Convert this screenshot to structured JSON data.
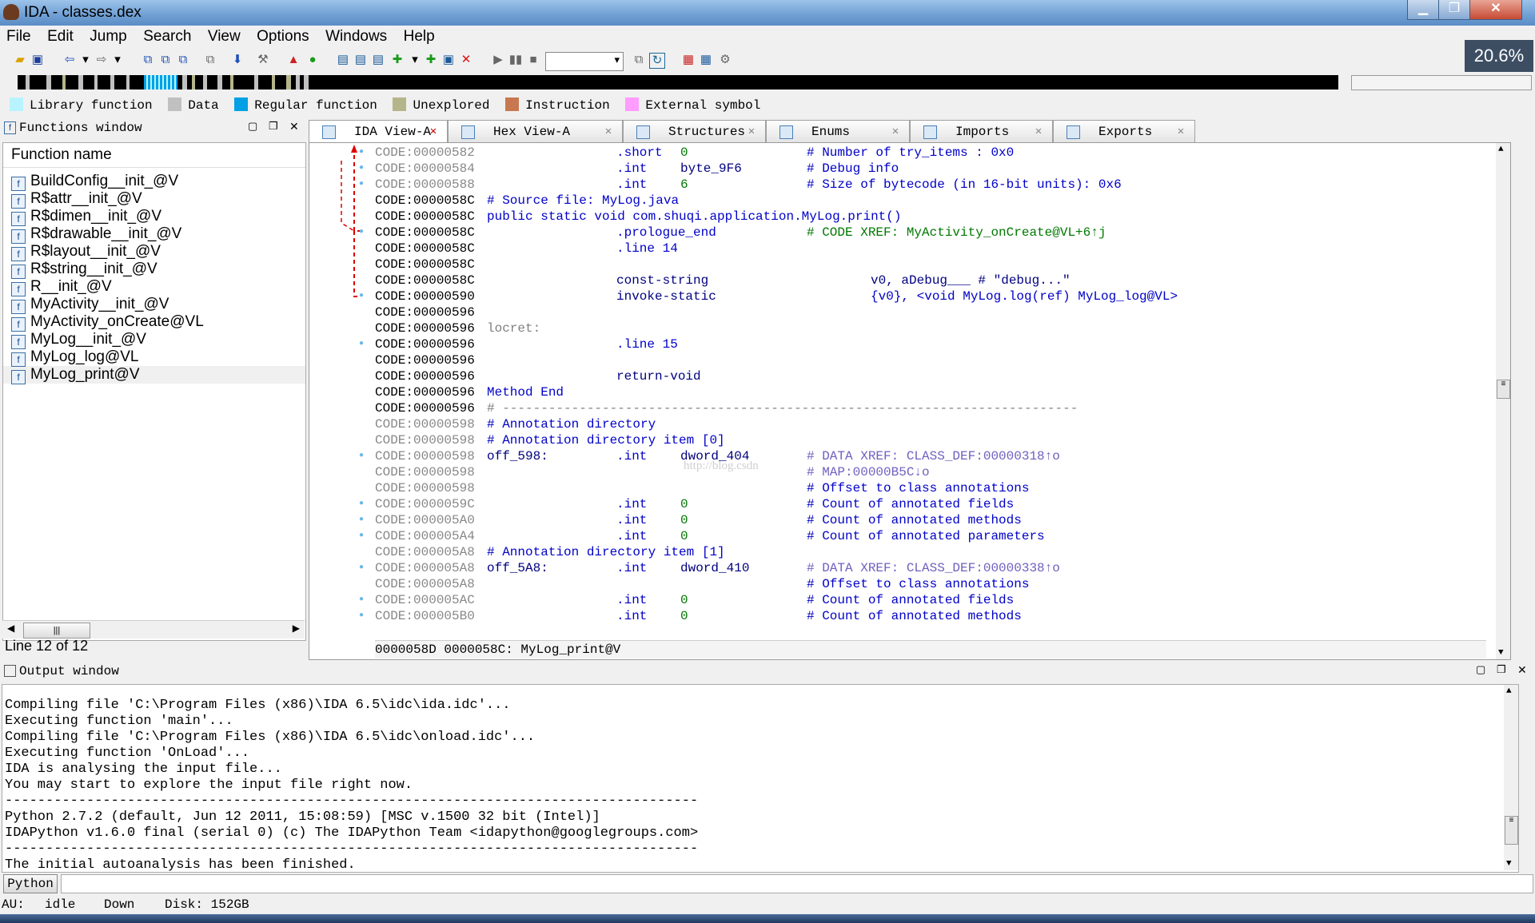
{
  "window": {
    "title": "IDA - classes.dex",
    "zoom": "20.6%"
  },
  "menu": [
    "File",
    "Edit",
    "Jump",
    "Search",
    "View",
    "Options",
    "Windows",
    "Help"
  ],
  "legend": [
    {
      "label": "Library function",
      "color": "#b8f4ff"
    },
    {
      "label": "Data",
      "color": "#c0c0c0"
    },
    {
      "label": "Regular function",
      "color": "#00a0e6"
    },
    {
      "label": "Unexplored",
      "color": "#b5b58a"
    },
    {
      "label": "Instruction",
      "color": "#c87850"
    },
    {
      "label": "External symbol",
      "color": "#ff9cff"
    }
  ],
  "functions": {
    "title": "Functions window",
    "column": "Function name",
    "items": [
      "BuildConfig__init_@V",
      "R$attr__init_@V",
      "R$dimen__init_@V",
      "R$drawable__init_@V",
      "R$layout__init_@V",
      "R$string__init_@V",
      "R__init_@V",
      "MyActivity__init_@V",
      "MyActivity_onCreate@VL",
      "MyLog__init_@V",
      "MyLog_log@VL",
      "MyLog_print@V"
    ],
    "selected": 11,
    "status": "Line 12 of 12"
  },
  "tabs": [
    "IDA View-A",
    "Hex View-A",
    "Structures",
    "Enums",
    "Imports",
    "Exports"
  ],
  "code": {
    "lines": [
      {
        "addr": "CODE:00000582",
        "addr_style": "gray",
        "dot": true,
        "ins": ".short",
        "op": "0",
        "op_color": "green",
        "cm": "# Number of try_items : 0x0"
      },
      {
        "addr": "CODE:00000584",
        "addr_style": "gray",
        "dot": true,
        "ins": ".int",
        "op": "byte_9F6",
        "op_color": "navy",
        "cm": "# Debug info"
      },
      {
        "addr": "CODE:00000588",
        "addr_style": "gray",
        "dot": true,
        "ins": ".int",
        "op": "6",
        "op_color": "green",
        "cm": "# Size of bytecode (in 16-bit units): 0x6"
      },
      {
        "addr": "CODE:0000058C",
        "addr_style": "dark",
        "lbl": "# Source file: MyLog.java",
        "lbl_color": "blue"
      },
      {
        "addr": "CODE:0000058C",
        "addr_style": "dark",
        "lbl": "public static void com.shuqi.application.MyLog.print()",
        "lbl_color": "blue"
      },
      {
        "addr": "CODE:0000058C",
        "addr_style": "dark",
        "dot": true,
        "ins": ".prologue_end",
        "cm": "# CODE XREF: MyActivity_onCreate@VL+6↑j",
        "cm_color": "green"
      },
      {
        "addr": "CODE:0000058C",
        "addr_style": "dark",
        "ins": ".line 14"
      },
      {
        "addr": "CODE:0000058C",
        "addr_style": "dark"
      },
      {
        "addr": "CODE:0000058C",
        "addr_style": "dark",
        "ins": "const-string",
        "ins_color": "navy",
        "op2": "v0, aDebug___ # \"debug...\"",
        "op2_color": "navy"
      },
      {
        "addr": "CODE:00000590",
        "addr_style": "dark",
        "dot": true,
        "ins": "invoke-static",
        "ins_color": "navy",
        "op2": "{v0}, <void MyLog.log(ref) MyLog_log@VL>",
        "op2_color": "blue"
      },
      {
        "addr": "CODE:00000596",
        "addr_style": "dark"
      },
      {
        "addr": "CODE:00000596",
        "addr_style": "dark",
        "lbl": "locret:",
        "lbl_color": "gray"
      },
      {
        "addr": "CODE:00000596",
        "addr_style": "dark",
        "dot": true,
        "ins": ".line 15"
      },
      {
        "addr": "CODE:00000596",
        "addr_style": "dark"
      },
      {
        "addr": "CODE:00000596",
        "addr_style": "dark",
        "ins": "return-void",
        "ins_color": "navy"
      },
      {
        "addr": "CODE:00000596",
        "addr_style": "dark",
        "lbl": "Method End",
        "lbl_color": "blue"
      },
      {
        "addr": "CODE:00000596",
        "addr_style": "dark",
        "lbl": "# ---------------------------------------------------------------------------",
        "lbl_color": "gray"
      },
      {
        "addr": "CODE:00000598",
        "addr_style": "gray",
        "lbl": "# Annotation directory",
        "lbl_color": "blue"
      },
      {
        "addr": "CODE:00000598",
        "addr_style": "gray",
        "lbl": "# Annotation directory item [0]",
        "lbl_color": "blue"
      },
      {
        "addr": "CODE:00000598",
        "addr_style": "gray",
        "dot": true,
        "lbl": "off_598:",
        "lbl_color": "navy",
        "ins": ".int",
        "op": "dword_404",
        "op_color": "navy",
        "cm": "# DATA XREF: CLASS_DEF:00000318↑o",
        "cm_color": "purple"
      },
      {
        "addr": "CODE:00000598",
        "addr_style": "gray",
        "cm": "# MAP:00000B5C↓o",
        "cm_color": "purple"
      },
      {
        "addr": "CODE:00000598",
        "addr_style": "gray",
        "cm": "# Offset to class annotations"
      },
      {
        "addr": "CODE:0000059C",
        "addr_style": "gray",
        "dot": true,
        "ins": ".int",
        "op": "0",
        "op_color": "green",
        "cm": "# Count of annotated fields"
      },
      {
        "addr": "CODE:000005A0",
        "addr_style": "gray",
        "dot": true,
        "ins": ".int",
        "op": "0",
        "op_color": "green",
        "cm": "# Count of annotated methods"
      },
      {
        "addr": "CODE:000005A4",
        "addr_style": "gray",
        "dot": true,
        "ins": ".int",
        "op": "0",
        "op_color": "green",
        "cm": "# Count of annotated parameters"
      },
      {
        "addr": "CODE:000005A8",
        "addr_style": "gray",
        "lbl": "# Annotation directory item [1]",
        "lbl_color": "blue"
      },
      {
        "addr": "CODE:000005A8",
        "addr_style": "gray",
        "dot": true,
        "lbl": "off_5A8:",
        "lbl_color": "navy",
        "ins": ".int",
        "op": "dword_410",
        "op_color": "navy",
        "cm": "# DATA XREF: CLASS_DEF:00000338↑o",
        "cm_color": "purple"
      },
      {
        "addr": "CODE:000005A8",
        "addr_style": "gray",
        "cm": "# Offset to class annotations"
      },
      {
        "addr": "CODE:000005AC",
        "addr_style": "gray",
        "dot": true,
        "ins": ".int",
        "op": "0",
        "op_color": "green",
        "cm": "# Count of annotated fields"
      },
      {
        "addr": "CODE:000005B0",
        "addr_style": "gray",
        "dot": true,
        "ins": ".int",
        "op": "0",
        "op_color": "green",
        "cm": "# Count of annotated methods"
      }
    ],
    "status": "0000058D 0000058C: MyLog_print@V",
    "watermark": "http://blog.csdn"
  },
  "output": {
    "title": "Output window",
    "lines": [
      "Compiling file 'C:\\Program Files (x86)\\IDA 6.5\\idc\\ida.idc'...",
      "Executing function 'main'...",
      "Compiling file 'C:\\Program Files (x86)\\IDA 6.5\\idc\\onload.idc'...",
      "Executing function 'OnLoad'...",
      "IDA is analysing the input file...",
      "You may start to explore the input file right now.",
      "-------------------------------------------------------------------------------------",
      "Python 2.7.2 (default, Jun 12 2011, 15:08:59) [MSC v.1500 32 bit (Intel)]",
      "IDAPython v1.6.0 final (serial 0) (c) The IDAPython Team <idapython@googlegroups.com>",
      "-------------------------------------------------------------------------------------",
      "The initial autoanalysis has been finished."
    ],
    "python_button": "Python"
  },
  "statusbar": {
    "au_label": "AU:",
    "au_state": "idle",
    "direction": "Down",
    "disk": "Disk: 152GB"
  }
}
